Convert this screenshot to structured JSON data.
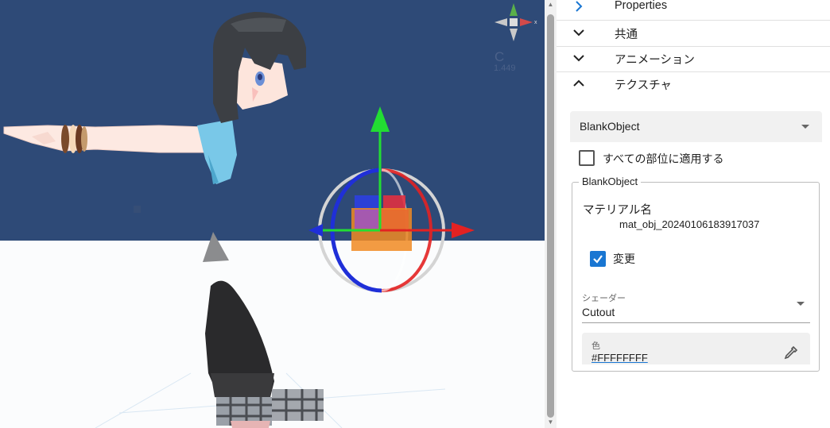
{
  "viewport": {
    "camera_label": "C",
    "camera_value": "1.449",
    "axis_x_label": "x"
  },
  "panel": {
    "sections": [
      {
        "label": "Properties",
        "state": "collapsed",
        "icon": "chevron-right-icon"
      },
      {
        "label": "共通",
        "state": "expanded-toggle",
        "icon": "chevron-down-icon"
      },
      {
        "label": "アニメーション",
        "state": "expanded-toggle",
        "icon": "chevron-down-icon"
      },
      {
        "label": "テクスチャ",
        "state": "open",
        "icon": "chevron-up-icon"
      }
    ],
    "object_select": {
      "value": "BlankObject"
    },
    "apply_all": {
      "label": "すべての部位に適用する",
      "checked": false
    },
    "material_group": {
      "legend": "BlankObject",
      "material_name_label": "マテリアル名",
      "material_name_value": "mat_obj_20240106183917037",
      "change": {
        "label": "変更",
        "checked": true
      },
      "shader": {
        "label": "シェーダー",
        "value": "Cutout"
      },
      "color": {
        "label": "色",
        "value": "#FFFFFFFF"
      }
    }
  },
  "colors": {
    "sky": "#2e4a77",
    "accent": "#1976d2",
    "gizmo_y": "#22dd33",
    "gizmo_x": "#e32222",
    "gizmo_z": "#1f2fd8",
    "gizmo_center": "#f08a22"
  }
}
